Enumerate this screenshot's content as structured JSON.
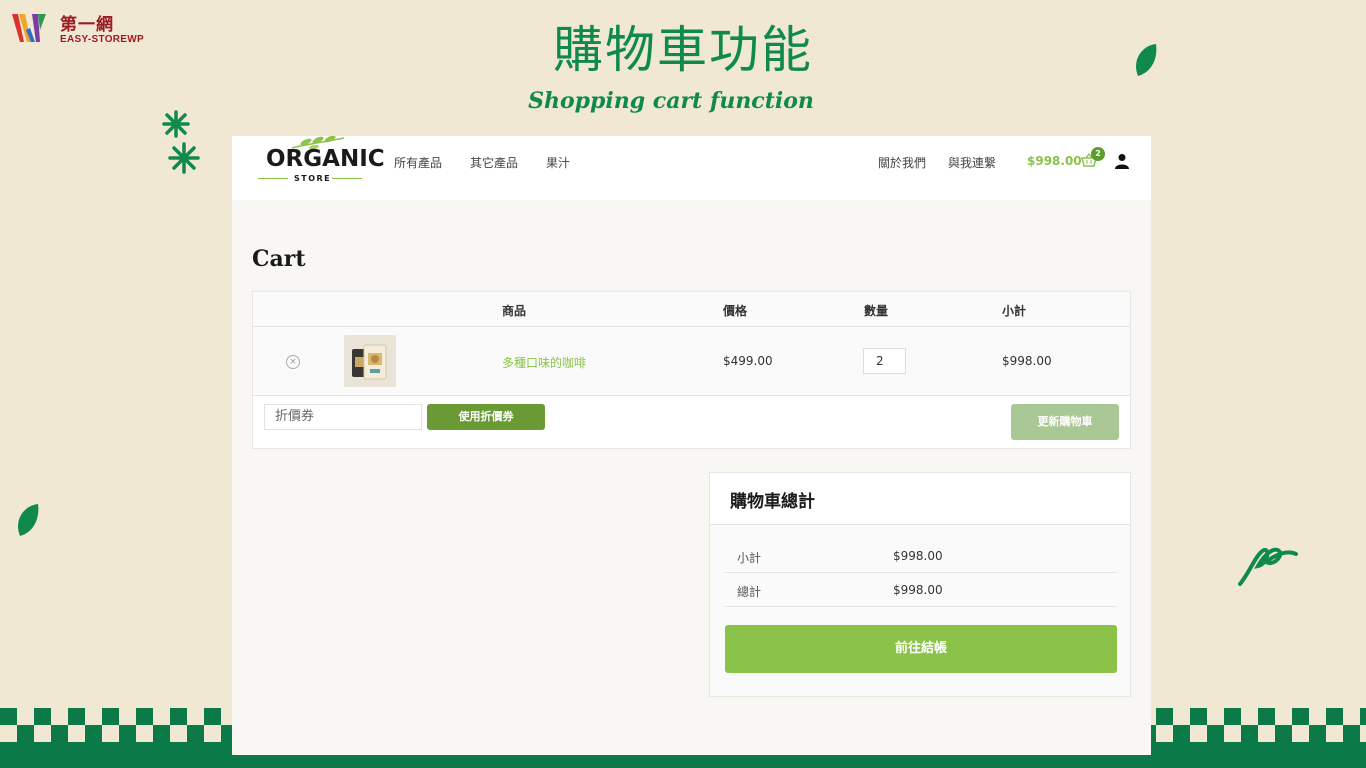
{
  "brand": {
    "name": "第一網",
    "sub": "EASY-STOREWP"
  },
  "slide": {
    "title": "購物車功能",
    "subtitle": "Shopping cart function"
  },
  "site": {
    "logo": {
      "text": "ORGANIC",
      "sub": "STORE"
    },
    "nav": [
      "所有產品",
      "其它產品",
      "果汁"
    ],
    "nav_right": [
      "關於我們",
      "與我連繫"
    ],
    "cart_total": "$998.00",
    "cart_count": "2"
  },
  "page": {
    "title": "Cart"
  },
  "cart": {
    "headers": {
      "product": "商品",
      "price": "價格",
      "quantity": "數量",
      "subtotal": "小計"
    },
    "items": [
      {
        "remove": "×",
        "name": "多種口味的咖啡",
        "price": "$499.00",
        "quantity": "2",
        "subtotal": "$998.00"
      }
    ],
    "coupon_placeholder": "折價券",
    "coupon_button": "使用折價券",
    "update_button": "更新購物車"
  },
  "totals": {
    "title": "購物車總計",
    "rows": [
      {
        "label": "小計",
        "value": "$998.00"
      },
      {
        "label": "總計",
        "value": "$998.00"
      }
    ],
    "checkout": "前往結帳"
  },
  "colors": {
    "background": "#f1e8d3",
    "slide_green": "#0f8a4c",
    "accent_green": "#8bc34a",
    "coupon_green": "#6a9a33",
    "update_disabled": "#a9c895",
    "brand_red": "#9b1c24"
  }
}
